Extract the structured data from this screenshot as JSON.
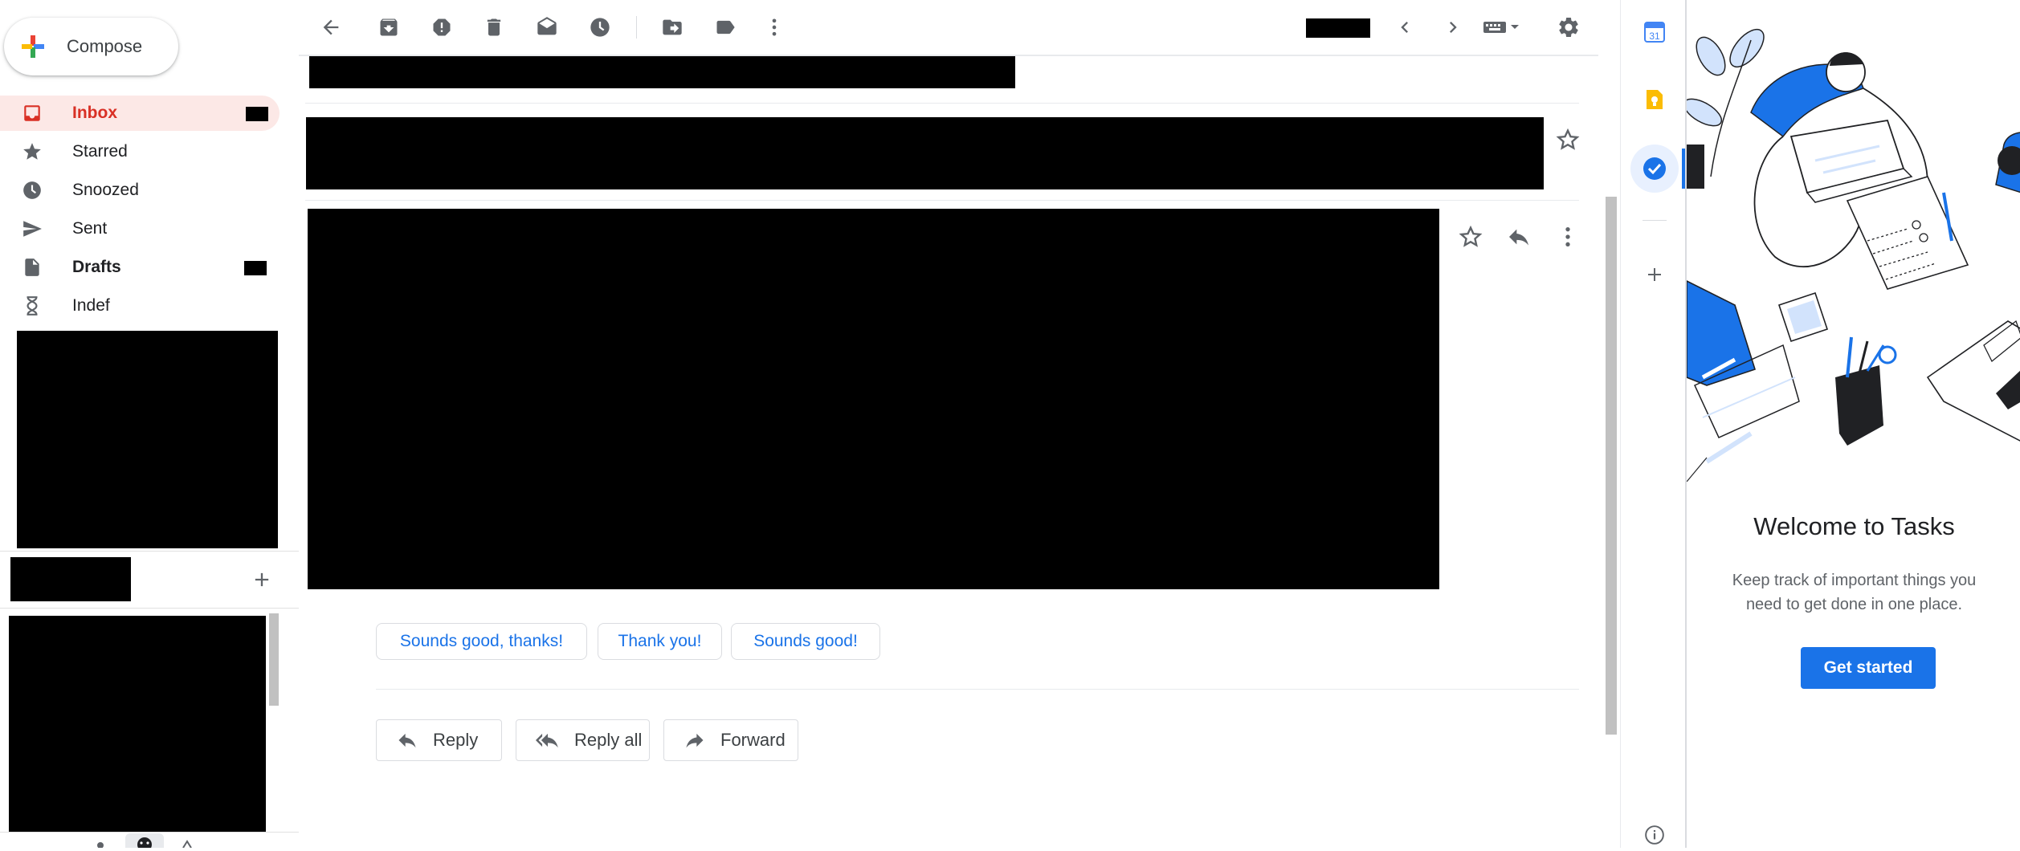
{
  "compose": {
    "label": "Compose"
  },
  "nav": [
    {
      "label": "Inbox",
      "active": true
    },
    {
      "label": "Starred"
    },
    {
      "label": "Snoozed"
    },
    {
      "label": "Sent"
    },
    {
      "label": "Drafts",
      "bold": true
    },
    {
      "label": "Indef"
    }
  ],
  "smart_replies": [
    "Sounds good, thanks!",
    "Thank you!",
    "Sounds good!"
  ],
  "actions": {
    "reply": "Reply",
    "reply_all": "Reply all",
    "forward": "Forward"
  },
  "rail": {
    "calendar_day": "31"
  },
  "tasks": {
    "title": "Welcome to Tasks",
    "desc_line1": "Keep track of important things you",
    "desc_line2": "need to get done in one place.",
    "cta": "Get started"
  },
  "colors": {
    "accent": "#1a73e8",
    "inbox_red": "#d93025",
    "inbox_bg": "#fce8e6"
  }
}
